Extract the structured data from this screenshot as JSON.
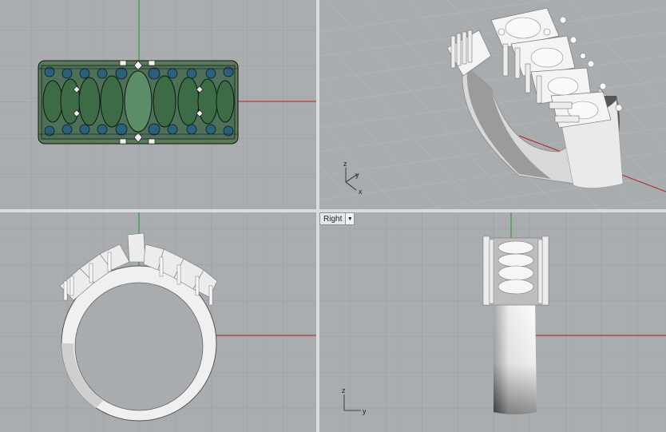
{
  "viewports": {
    "top": {
      "name": ""
    },
    "perspective": {
      "name": ""
    },
    "front": {
      "name": ""
    },
    "right": {
      "name": "Right"
    }
  },
  "axes": {
    "x": "x",
    "y": "y",
    "z": "z"
  },
  "icons": {
    "viewport_dropdown": "chevron-down-icon"
  },
  "colors": {
    "viewport_bg": "#a9acaf",
    "grid_minor": "#b4b7ba",
    "grid_major": "#96999d",
    "x_axis": "#b02020",
    "y_axis": "#1a9a2a",
    "stone_green": "#3d6b45",
    "stone_blue": "#2c5f78",
    "metal": "#e6e6e6"
  }
}
